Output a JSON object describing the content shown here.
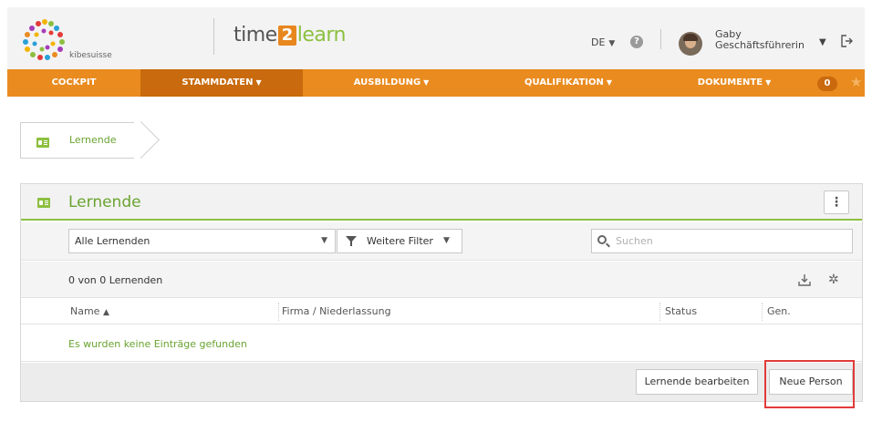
{
  "header": {
    "logo_text": "kibesuisse",
    "brand": {
      "part1": "time",
      "part2": "2",
      "part3": "learn"
    },
    "language": "DE",
    "help_glyph": "?",
    "user": {
      "name": "Gaby",
      "role": "Geschäftsführerin"
    },
    "icons": {
      "logout": "logout-icon",
      "help": "help-icon",
      "avatar": "avatar"
    }
  },
  "nav": {
    "items": [
      {
        "label": "COCKPIT",
        "has_menu": false,
        "active": false
      },
      {
        "label": "STAMMDATEN",
        "has_menu": true,
        "active": true
      },
      {
        "label": "AUSBILDUNG",
        "has_menu": true,
        "active": false
      },
      {
        "label": "QUALIFIKATION",
        "has_menu": true,
        "active": false
      },
      {
        "label": "DOKUMENTE",
        "has_menu": true,
        "active": false
      }
    ],
    "badge_count": "0",
    "caret": "▼",
    "accent_color": "#e98b1f",
    "active_color": "#c86a0d"
  },
  "breadcrumb": {
    "label": "Lernende"
  },
  "panel": {
    "title": "Lernende",
    "menu_glyph": "⋮",
    "filter_select": {
      "value": "Alle Lernenden"
    },
    "filter_button": {
      "label": "Weitere Filter"
    },
    "search": {
      "placeholder": "Suchen",
      "value": ""
    },
    "count_text": "0 von 0 Lernenden",
    "columns": [
      {
        "label": "Name",
        "sort": "▲"
      },
      {
        "label": "Firma / Niederlassung"
      },
      {
        "label": "Status"
      },
      {
        "label": "Gen."
      }
    ],
    "empty_message": "Es wurden keine Einträge gefunden",
    "actions": {
      "edit_label": "Lernende bearbeiten",
      "new_label": "Neue Person"
    },
    "accent_color": "#8cbf3f"
  }
}
